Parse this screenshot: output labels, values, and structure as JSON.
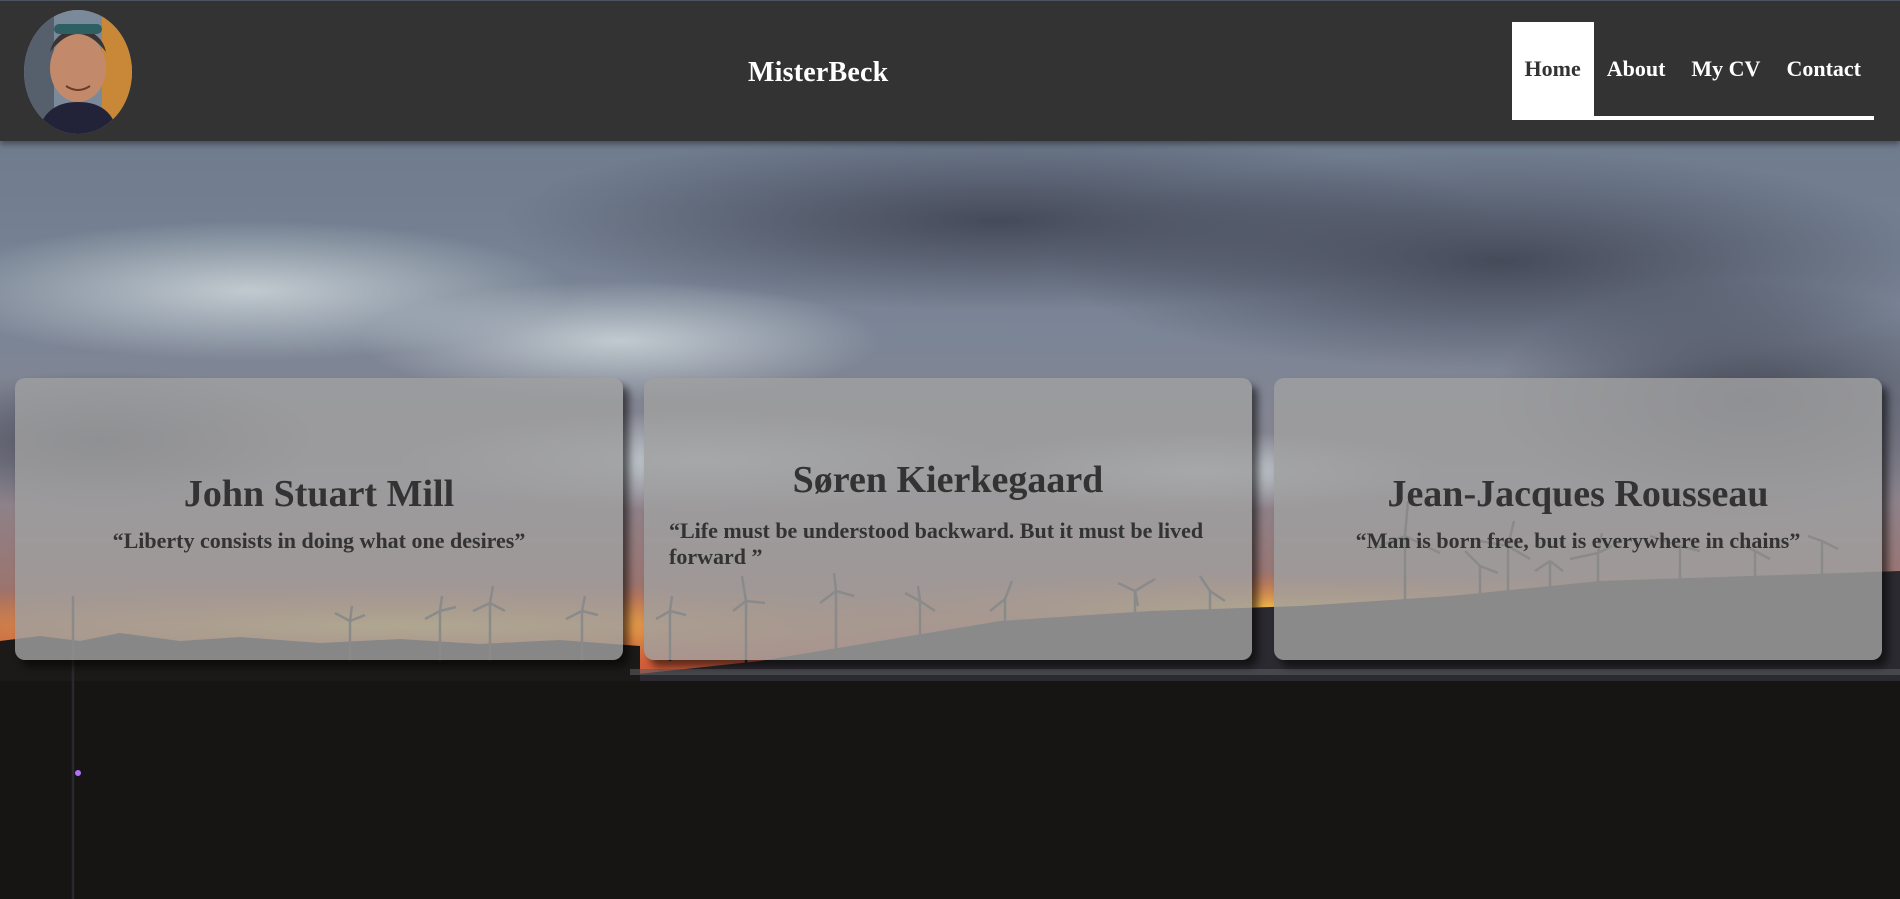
{
  "header": {
    "site_title": "MisterBeck",
    "nav": [
      {
        "label": "Home",
        "active": true
      },
      {
        "label": "About",
        "active": false
      },
      {
        "label": "My CV",
        "active": false
      },
      {
        "label": "Contact",
        "active": false
      }
    ]
  },
  "cards": [
    {
      "name": "John Stuart Mill",
      "quote": "“Liberty consists in doing what one desires”"
    },
    {
      "name": "Søren Kierkegaard",
      "quote": "“Life must be understood backward. But it must be lived forward ”"
    },
    {
      "name": "Jean-Jacques Rousseau",
      "quote": "“Man is born free, but is everywhere in chains”"
    }
  ],
  "colors": {
    "header_bg": "#333333",
    "nav_active_bg": "#ffffff",
    "card_bg": "rgba(160,160,160,0.82)",
    "text_dark": "#333333"
  }
}
